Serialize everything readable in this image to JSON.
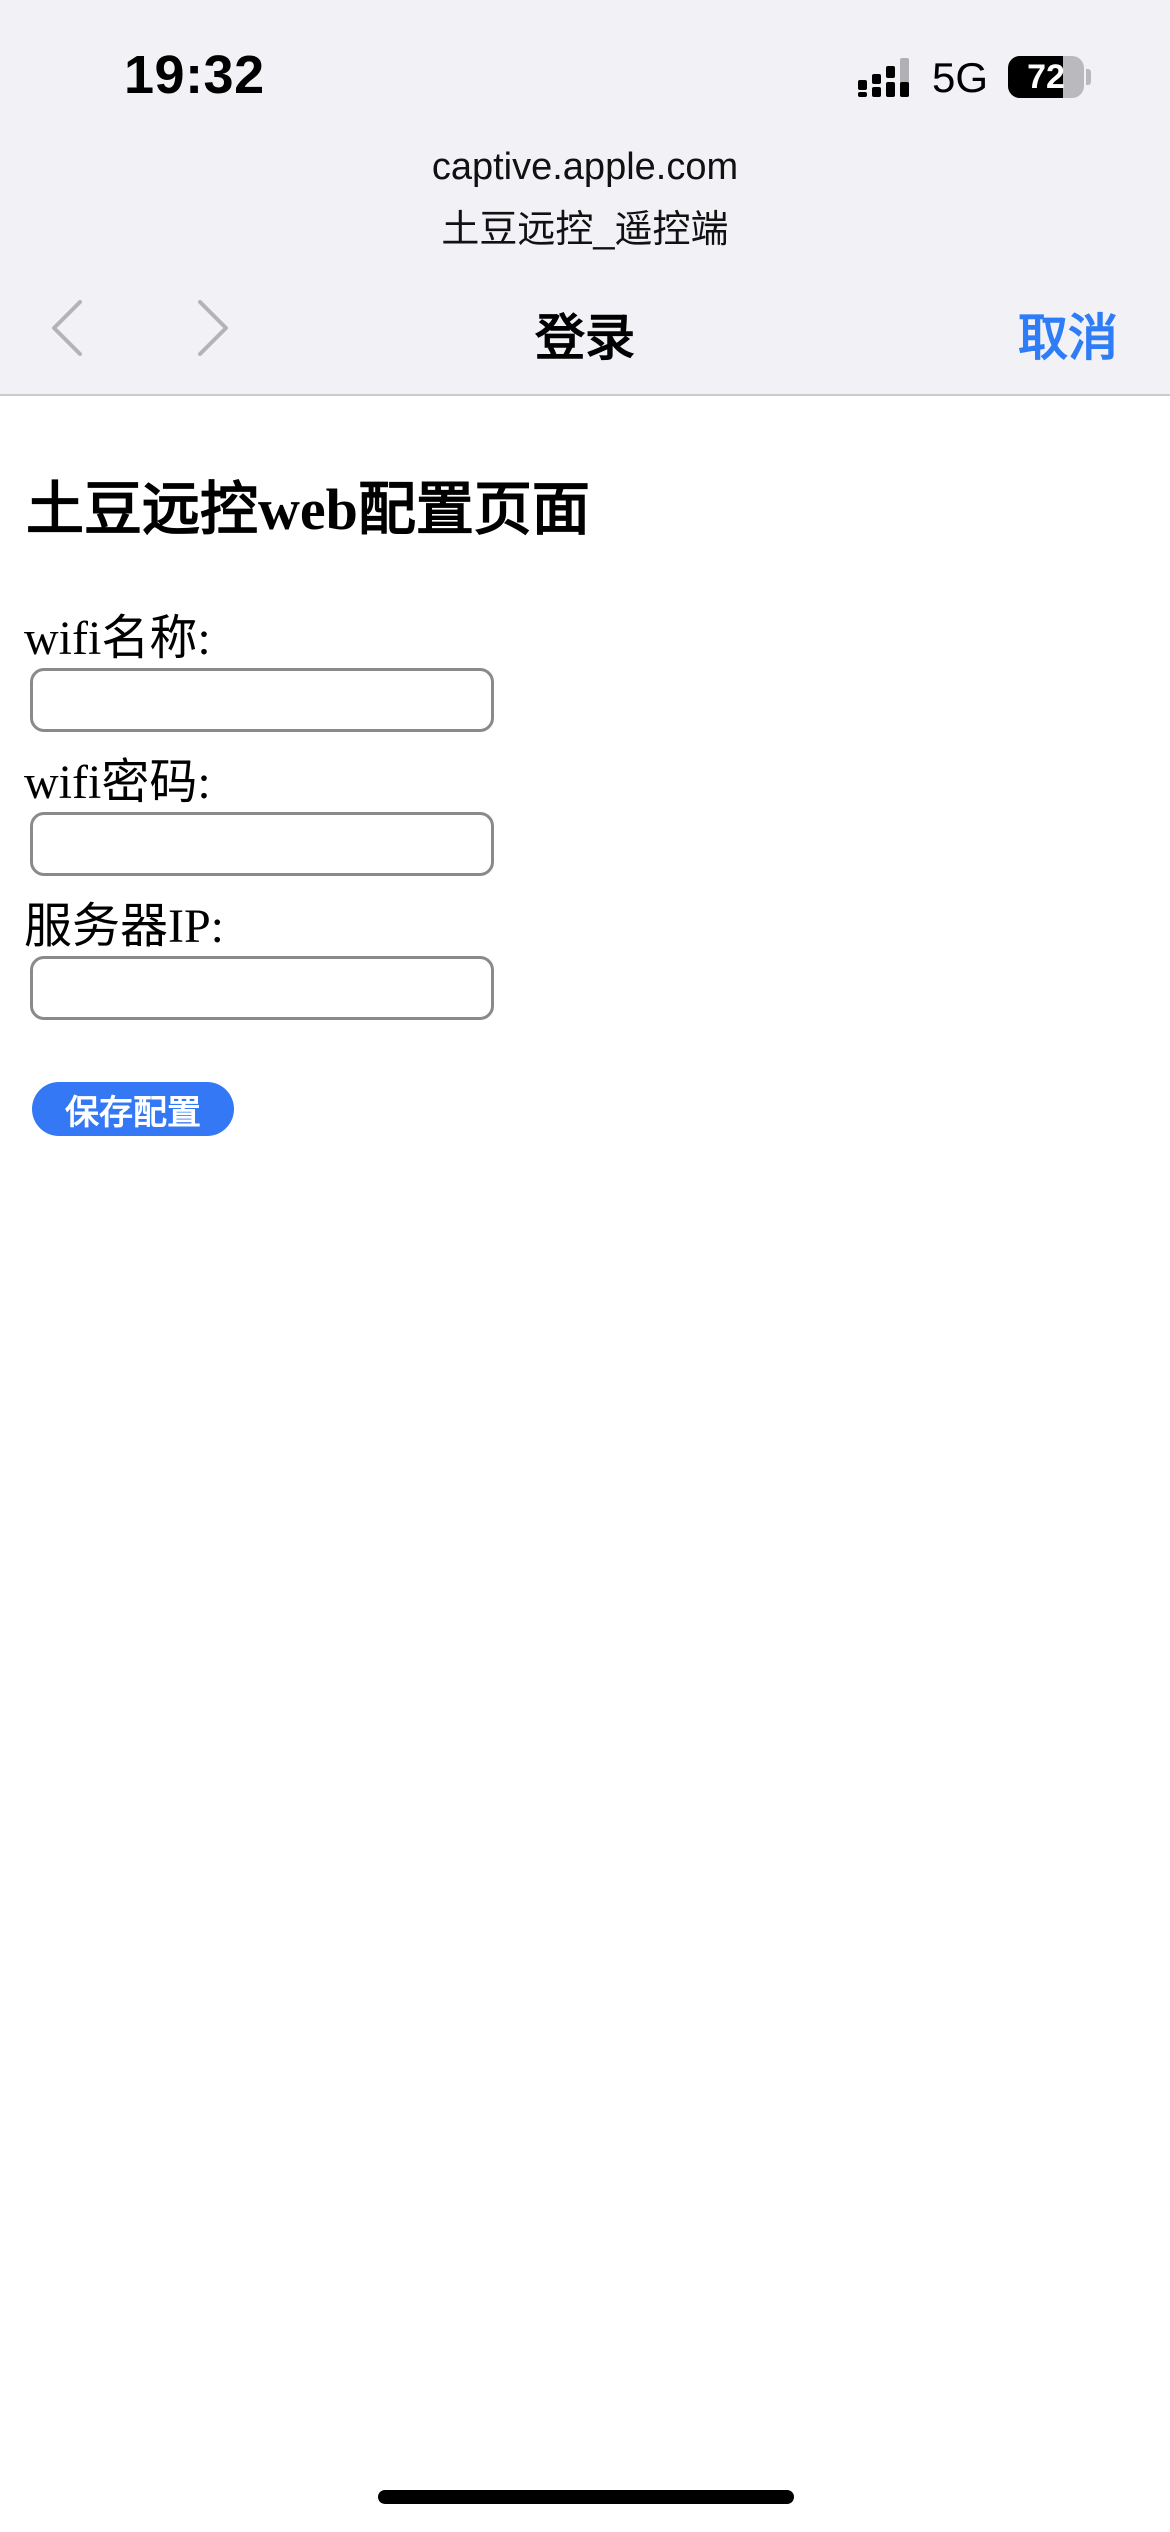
{
  "status_bar": {
    "time": "19:32",
    "network": "5G",
    "battery_percent": "72",
    "battery_level": 0.72
  },
  "browser": {
    "url": "captive.apple.com",
    "ssid": "土豆远控_遥控端",
    "title": "登录",
    "cancel_label": "取消",
    "back_icon": "chevron-left-icon",
    "forward_icon": "chevron-right-icon"
  },
  "page": {
    "heading": "土豆远控web配置页面",
    "fields": [
      {
        "label": "wifi名称:",
        "value": "",
        "placeholder": ""
      },
      {
        "label": "wifi密码:",
        "value": "",
        "placeholder": ""
      },
      {
        "label": "服务器IP:",
        "value": "",
        "placeholder": ""
      }
    ],
    "save_label": "保存配置"
  },
  "colors": {
    "accent": "#2e7cf6",
    "button": "#3478f6",
    "topbar_bg": "#f1f1f6"
  }
}
